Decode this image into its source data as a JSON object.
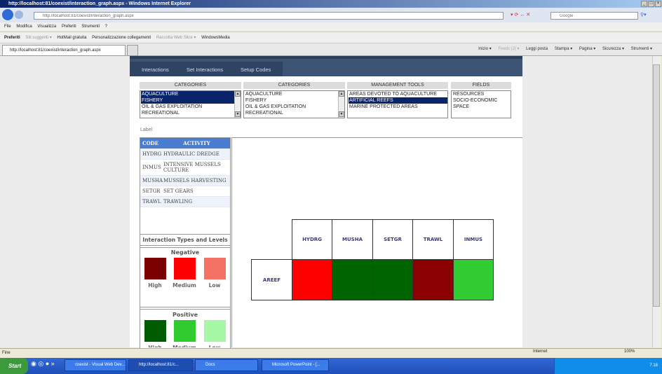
{
  "browser": {
    "title": "http://localhost:81/coexist/interaction_graph.aspx - Windows Internet Explorer",
    "address": "http://localhost:81/coexist/interaction_graph.aspx",
    "search_placeholder": "Google",
    "menu": [
      "File",
      "Modifica",
      "Visualizza",
      "Preferiti",
      "Strumenti",
      "?"
    ],
    "favorites": [
      "Preferiti",
      "Siti suggeriti ▾",
      "HotMail gratuita",
      "Personalizzazione collegamenti",
      "Raccolta Web Slice ▾",
      "WindowsMedia"
    ],
    "tab_title": "http://localhost:81/coexist/interaction_graph.aspx",
    "commands": [
      "Inizio ▾",
      "Feeds (J) ▾",
      "Leggi posta",
      "Stampa ▾",
      "Pagina ▾",
      "Sicurezza ▾",
      "Strumenti ▾"
    ],
    "status": "Fine",
    "zone": "Internet",
    "zoom": "100%"
  },
  "nav": {
    "tabs": [
      "Interactions",
      "Set Interactions",
      "Setup Codes"
    ]
  },
  "filters": [
    {
      "header": "CATEGORIES",
      "items": [
        "AQUACULTURE",
        "FISHERY",
        "OIL & GAS EXPLOITATION",
        "RECREATIONAL"
      ],
      "selected": [
        0,
        1
      ]
    },
    {
      "header": "CATEGORIES",
      "items": [
        "AQUACULTURE",
        "FISHERY",
        "OIL & GAS EXPLOITATION",
        "RECREATIONAL"
      ],
      "selected": []
    },
    {
      "header": "MANAGEMENT TOOLS",
      "items": [
        "AREAS DEVOTED TO AQUACULTURE",
        "ARTIFICIAL REEFS",
        "MARINE PROTECTED AREAS"
      ],
      "selected": [
        1
      ]
    },
    {
      "header": "FIELDS",
      "items": [
        "RESOURCES",
        "SOCIO-ECONOMIC",
        "SPACE"
      ],
      "selected": []
    }
  ],
  "label": "Label",
  "code_table": {
    "headers": [
      "CODE",
      "ACTIVITY"
    ],
    "rows": [
      [
        "HYDRG",
        "HYDRAULIC DREDGE"
      ],
      [
        "INMUS",
        "INTENSIVE MUSSELS CULTURE"
      ],
      [
        "MUSHA",
        "MUSSELS HARVESTING"
      ],
      [
        "SETGR",
        "SET GEARS"
      ],
      [
        "TRAWL",
        "TRAWLING"
      ]
    ]
  },
  "legend": {
    "title": "Interaction Types and Levels",
    "negative": {
      "title": "Negative",
      "levels": [
        {
          "label": "High",
          "color": "#7a0000"
        },
        {
          "label": "Medium",
          "color": "#ff0000"
        },
        {
          "label": "Low",
          "color": "#f47264"
        }
      ]
    },
    "positive": {
      "title": "Positive",
      "levels": [
        {
          "label": "High",
          "color": "#005c00"
        },
        {
          "label": "Medium",
          "color": "#2fcb2f"
        },
        {
          "label": "Low",
          "color": "#a6f7a6"
        }
      ]
    }
  },
  "matrix": {
    "columns": [
      "HYDRG",
      "MUSHA",
      "SETGR",
      "TRAWL",
      "INMUS"
    ],
    "rows": [
      {
        "label": "AREEF",
        "cells": [
          {
            "type": "Negative",
            "level": "Medium",
            "color": "#ff0000"
          },
          {
            "type": "Positive",
            "level": "High",
            "color": "#006400"
          },
          {
            "type": "Positive",
            "level": "High",
            "color": "#006400"
          },
          {
            "type": "Negative",
            "level": "High",
            "color": "#8b0000"
          },
          {
            "type": "Positive",
            "level": "Medium",
            "color": "#32cd32"
          }
        ]
      }
    ]
  },
  "taskbar": {
    "start": "Start",
    "items": [
      "coexist - Visual Web Dev...",
      "http://localhost:81/c...",
      "Docs",
      "Microsoft PowerPoint - [..."
    ],
    "clock": "7.18"
  }
}
